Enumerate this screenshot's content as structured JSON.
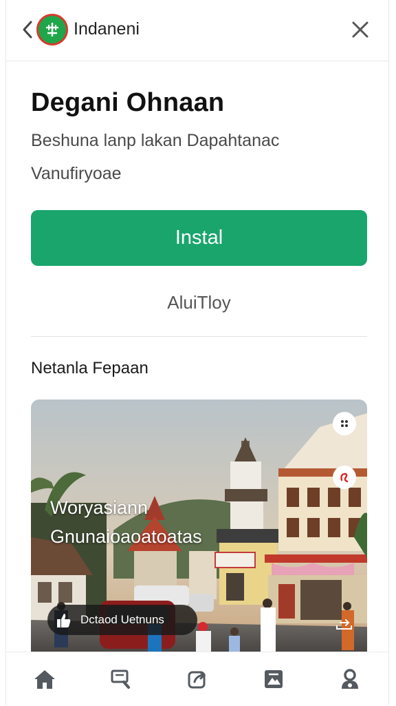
{
  "header": {
    "back_icon": "chevron-left-icon",
    "app_name": "Indaneni",
    "logo_icon": "app-logo-icon",
    "close_icon": "close-icon"
  },
  "app": {
    "title": "Degani Ohnaan",
    "subtitle": "Beshuna lanp lakan Dapahtanac",
    "subtitle2": "Vanufiryoae",
    "install_label": "Instal",
    "secondary_label": "AluiTloy"
  },
  "section": {
    "title": "Netanla Fepaan"
  },
  "hero": {
    "overlay_line1": "Woryasiann",
    "overlay_line2": "Gnunaioaoatoatas",
    "chip_label": "Dctaod Uetnuns",
    "chip_icon": "thumbs-up-icon",
    "top_button_icon": "dots-icon",
    "mid_button_icon": "cursive-icon",
    "share_icon": "share-icon"
  },
  "bottom_nav": [
    {
      "icon": "home-icon"
    },
    {
      "icon": "search-icon"
    },
    {
      "icon": "share-icon"
    },
    {
      "icon": "gallery-icon"
    },
    {
      "icon": "profile-icon"
    }
  ],
  "colors": {
    "accent": "#1aa56d",
    "logo_green": "#1fa64a",
    "logo_ring": "#d63b2f"
  }
}
